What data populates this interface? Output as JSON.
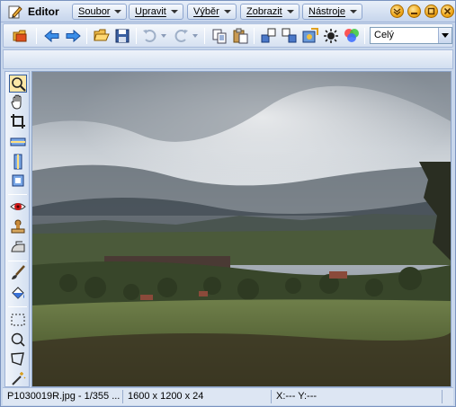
{
  "app": {
    "title": "Editor"
  },
  "menu": [
    {
      "label": "Soubor"
    },
    {
      "label": "Upravit"
    },
    {
      "label": "Výběr"
    },
    {
      "label": "Zobrazit"
    },
    {
      "label": "Nástroje"
    }
  ],
  "window_buttons": [
    "chevron-down-icon",
    "minimize-icon",
    "restore-icon",
    "close-icon"
  ],
  "toolbar": {
    "icons": [
      "open-folder-icon",
      "back-arrow-icon",
      "forward-arrow-icon",
      "open-file-icon",
      "save-icon",
      "undo-icon",
      "redo-icon",
      "copy-icon",
      "paste-icon",
      "resize-icon",
      "crop-icon",
      "effects-icon",
      "color-adjust-icon",
      "color-wheel-icon"
    ],
    "zoom_value": "Celý"
  },
  "tools": [
    "zoom-tool",
    "hand-tool",
    "crop-tool",
    "straighten-tool",
    "resize-vertical-tool",
    "fit-tool",
    "red-eye-tool",
    "stamp-tool",
    "clone-tool",
    "brush-tool",
    "fill-tool",
    "rect-select-tool",
    "ellipse-select-tool",
    "lasso-select-tool",
    "magic-wand-tool"
  ],
  "status": {
    "file": "P1030019R.jpg - 1/355 ...",
    "dimensions": "1600 x 1200 x 24",
    "coords": "X:---   Y:---"
  },
  "colors": {
    "accent": "#fde7a6",
    "chrome": "#c8d7ec",
    "border": "#9fb3d6"
  }
}
